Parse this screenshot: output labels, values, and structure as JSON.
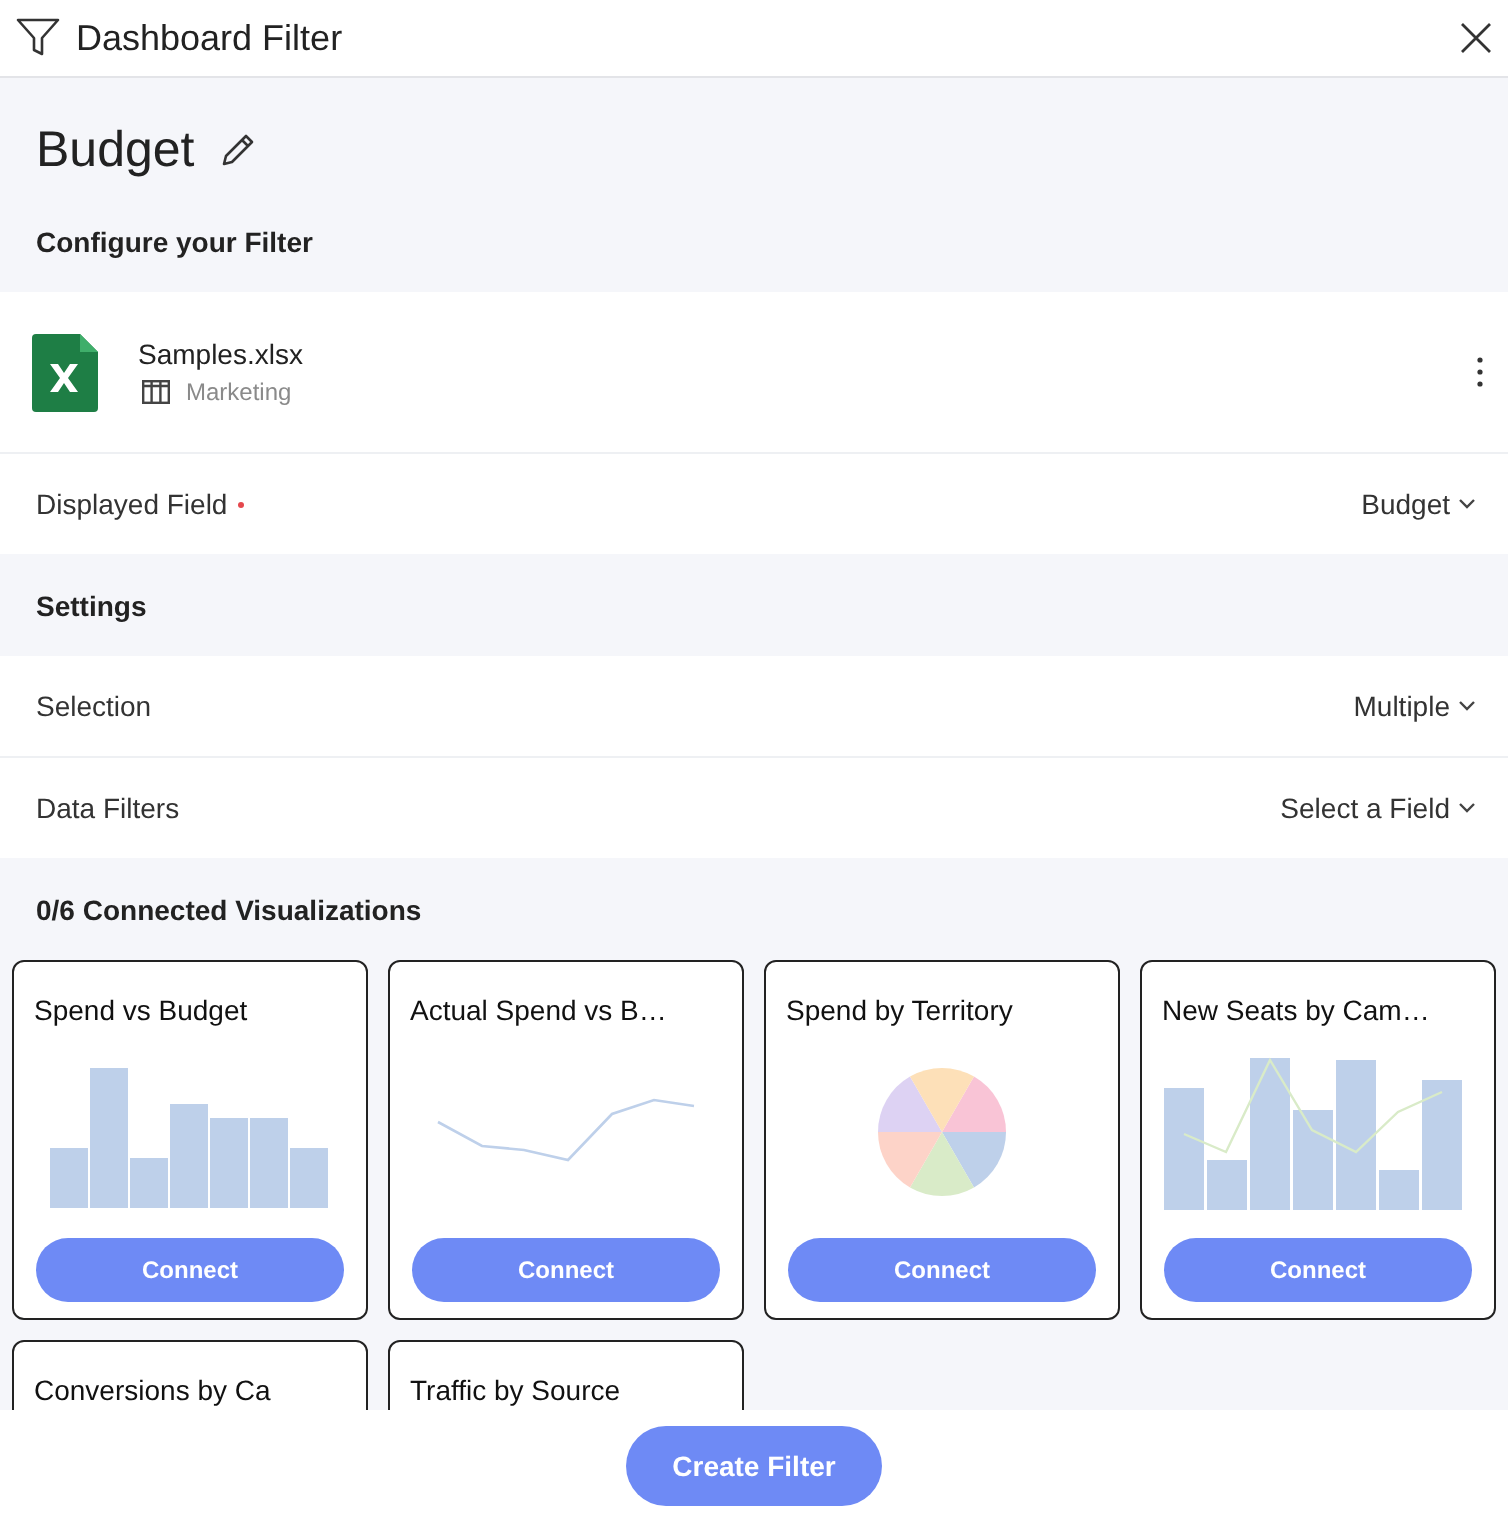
{
  "window": {
    "title": "Dashboard Filter"
  },
  "filter": {
    "name": "Budget",
    "section_title": "Configure your Filter"
  },
  "data_source": {
    "file": "Samples.xlsx",
    "sheet": "Marketing"
  },
  "displayed_field": {
    "label": "Displayed Field",
    "required": true,
    "value": "Budget"
  },
  "settings": {
    "title": "Settings",
    "rows": [
      {
        "label": "Selection",
        "value": "Multiple"
      },
      {
        "label": "Data Filters",
        "value": "Select a Field"
      }
    ]
  },
  "visualizations": {
    "title": "0/6 Connected Visualizations",
    "cards": [
      {
        "title": "Spend vs Budget",
        "kind": "bar",
        "button": "Connect"
      },
      {
        "title": "Actual Spend vs B…",
        "kind": "line",
        "button": "Connect"
      },
      {
        "title": "Spend by Territory",
        "kind": "pie",
        "button": "Connect"
      },
      {
        "title": "New Seats by Cam…",
        "kind": "combo",
        "button": "Connect"
      },
      {
        "title": "Conversions by Ca"
      },
      {
        "title": "Traffic by Source"
      }
    ]
  },
  "footer": {
    "button": "Create Filter"
  }
}
